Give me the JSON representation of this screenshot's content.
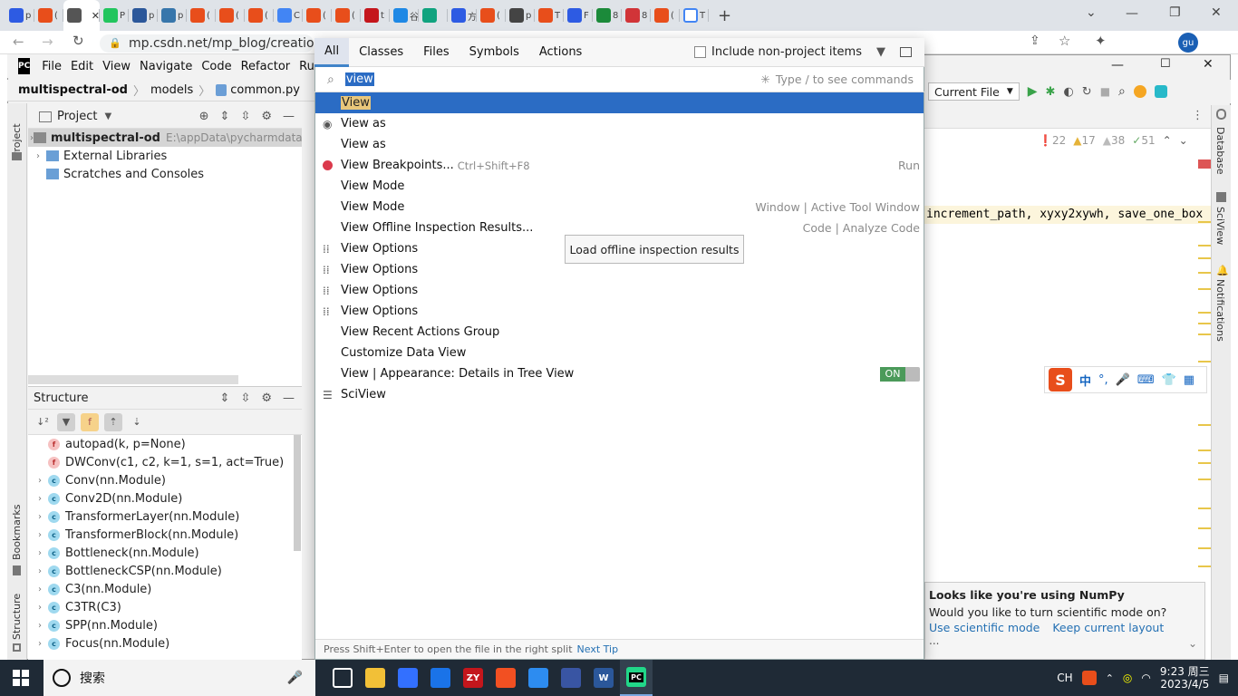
{
  "browser": {
    "tabs": [
      {
        "icon": "baidu-paw-icon",
        "color": "#2d5be3",
        "label": "p"
      },
      {
        "icon": "csdn-icon",
        "color": "#e84e1b",
        "label": "("
      },
      {
        "icon": "csdn-editor-icon",
        "color": "#555555",
        "label": "",
        "active": true
      },
      {
        "icon": "wechat-icon",
        "color": "#22c55e",
        "label": "P"
      },
      {
        "icon": "blue-square-icon",
        "color": "#2b579a",
        "label": "p"
      },
      {
        "icon": "python-icon",
        "color": "#3776ab",
        "label": "p"
      },
      {
        "icon": "csdn-icon",
        "color": "#e84e1b",
        "label": "("
      },
      {
        "icon": "csdn-icon",
        "color": "#e84e1b",
        "label": "("
      },
      {
        "icon": "csdn-icon",
        "color": "#e84e1b",
        "label": "("
      },
      {
        "icon": "translate-icon",
        "color": "#4285f4",
        "label": "C"
      },
      {
        "icon": "csdn-icon",
        "color": "#e84e1b",
        "label": "("
      },
      {
        "icon": "csdn-icon",
        "color": "#e84e1b",
        "label": "("
      },
      {
        "icon": "fiftyone-icon",
        "color": "#c4161c",
        "label": "t"
      },
      {
        "icon": "person-icon",
        "color": "#1e88e5",
        "label": "谷"
      },
      {
        "icon": "green-app-icon",
        "color": "#10a37f",
        "label": ""
      },
      {
        "icon": "baidu-paw-icon",
        "color": "#2d5be3",
        "label": "方"
      },
      {
        "icon": "csdn-icon",
        "color": "#e84e1b",
        "label": "("
      },
      {
        "icon": "barcode-icon",
        "color": "#444444",
        "label": "p"
      },
      {
        "icon": "jian-icon",
        "color": "#e84e1b",
        "label": "T"
      },
      {
        "icon": "baidu-paw-icon",
        "color": "#2d5be3",
        "label": "F"
      },
      {
        "icon": "green-square-icon",
        "color": "#1b8a3a",
        "label": "8"
      },
      {
        "icon": "red-square-icon",
        "color": "#d13438",
        "label": "8"
      },
      {
        "icon": "csdn-icon",
        "color": "#e84e1b",
        "label": "("
      },
      {
        "icon": "google-icon",
        "color": "#4285f4",
        "label": "T"
      }
    ],
    "url": "mp.csdn.net/mp_blog/creation",
    "active_close": "✕"
  },
  "pycharm": {
    "logo": "PC",
    "menu": [
      "File",
      "Edit",
      "View",
      "Navigate",
      "Code",
      "Refactor",
      "Ru"
    ],
    "breadcrumb": {
      "project": "multispectral-od",
      "folder": "models",
      "file": "common.py"
    },
    "left_stripe": {
      "project": "Project",
      "bookmarks": "Bookmarks",
      "structure": "Structure"
    },
    "project_pane": {
      "title": "Project",
      "rows": [
        {
          "label": "multispectral-od",
          "path": "E:\\appData\\pycharmdata\\m",
          "bold": true
        },
        {
          "label": "External Libraries"
        },
        {
          "label": "Scratches and Consoles"
        }
      ]
    },
    "structure_pane": {
      "title": "Structure",
      "rows": [
        {
          "kind": "f",
          "label": "autopad(k, p=None)"
        },
        {
          "kind": "f",
          "label": "DWConv(c1, c2, k=1, s=1, act=True)"
        },
        {
          "kind": "c",
          "label": "Conv(nn.Module)"
        },
        {
          "kind": "c",
          "label": "Conv2D(nn.Module)"
        },
        {
          "kind": "c",
          "label": "TransformerLayer(nn.Module)"
        },
        {
          "kind": "c",
          "label": "TransformerBlock(nn.Module)"
        },
        {
          "kind": "c",
          "label": "Bottleneck(nn.Module)"
        },
        {
          "kind": "c",
          "label": "BottleneckCSP(nn.Module)"
        },
        {
          "kind": "c",
          "label": "C3(nn.Module)"
        },
        {
          "kind": "c",
          "label": "C3TR(C3)"
        },
        {
          "kind": "c",
          "label": "SPP(nn.Module)"
        },
        {
          "kind": "c",
          "label": "Focus(nn.Module)"
        }
      ]
    },
    "run_config": "Current File",
    "inspection": {
      "errors": "22",
      "warnings": "17",
      "weak": "38",
      "typos": "51"
    },
    "code_line": "increment_path, xyxy2xywh, save_one_box",
    "right_stripe": {
      "database": "Database",
      "sciview": "SciView",
      "notifications": "Notifications"
    },
    "notification": {
      "title": "Looks like you're using NumPy",
      "body": "Would you like to turn scientific mode on?",
      "action1": "Use scientific mode",
      "action2": "Keep current layout",
      "more": "..."
    }
  },
  "search_popup": {
    "tabs": [
      "All",
      "Classes",
      "Files",
      "Symbols",
      "Actions"
    ],
    "selected_tab": "All",
    "include_label": "Include non-project items",
    "query": "view",
    "hint": "Type / to see commands",
    "results": [
      {
        "label": "View",
        "hint": "",
        "icon": "",
        "selected": true
      },
      {
        "label": "View as",
        "hint": "",
        "icon": "eye-icon"
      },
      {
        "label": "View as",
        "hint": "",
        "icon": ""
      },
      {
        "label": "View Breakpoints...",
        "shortcut": "Ctrl+Shift+F8",
        "hint": "Run",
        "icon": "breakpoint-icon"
      },
      {
        "label": "View Mode",
        "hint": "",
        "icon": ""
      },
      {
        "label": "View Mode",
        "hint": "Window | Active Tool Window",
        "icon": ""
      },
      {
        "label": "View Offline Inspection Results...",
        "hint": "Code | Analyze Code",
        "icon": ""
      },
      {
        "label": "View Options",
        "hint": "",
        "icon": "grid-icon"
      },
      {
        "label": "View Options",
        "hint": "",
        "icon": "grid-icon"
      },
      {
        "label": "View Options",
        "hint": "",
        "icon": "grid-icon"
      },
      {
        "label": "View Options",
        "hint": "",
        "icon": "grid-icon"
      },
      {
        "label": "View Recent Actions Group",
        "hint": "",
        "icon": ""
      },
      {
        "label": "Customize Data View",
        "hint": "",
        "icon": ""
      },
      {
        "label": "View | Appearance: Details in Tree View",
        "hint": "",
        "icon": "",
        "toggle": "ON"
      },
      {
        "label": "SciView",
        "hint": "",
        "icon": "list-icon"
      }
    ],
    "tooltip": "Load offline inspection results",
    "footer": {
      "tip": "Press Shift+Enter to open the file in the right split",
      "link": "Next Tip"
    }
  },
  "taskbar": {
    "search_label": "搜索",
    "apps": [
      {
        "name": "task-view",
        "color": "#1f2a36",
        "label": ""
      },
      {
        "name": "file-explorer",
        "color": "#f2c037",
        "label": ""
      },
      {
        "name": "feishu",
        "color": "#3370ff",
        "label": ""
      },
      {
        "name": "chrome",
        "color": "#1a73e8",
        "label": ""
      },
      {
        "name": "zy",
        "color": "#c4161c",
        "label": "ZY"
      },
      {
        "name": "orange-app",
        "color": "#f25022",
        "label": ""
      },
      {
        "name": "baidu-netdisk",
        "color": "#2d8cf0",
        "label": ""
      },
      {
        "name": "visio",
        "color": "#3955a3",
        "label": ""
      },
      {
        "name": "word",
        "color": "#2b579a",
        "label": "W"
      },
      {
        "name": "pycharm",
        "color": "#21d789",
        "label": "PC"
      }
    ],
    "tray": {
      "ime": "CH",
      "time": "9:23 周三",
      "date": "2023/4/5"
    }
  },
  "colors": {
    "accent": "#2b6cc4",
    "highlight": "#e9c77b",
    "csdn": "#e84e1b"
  }
}
